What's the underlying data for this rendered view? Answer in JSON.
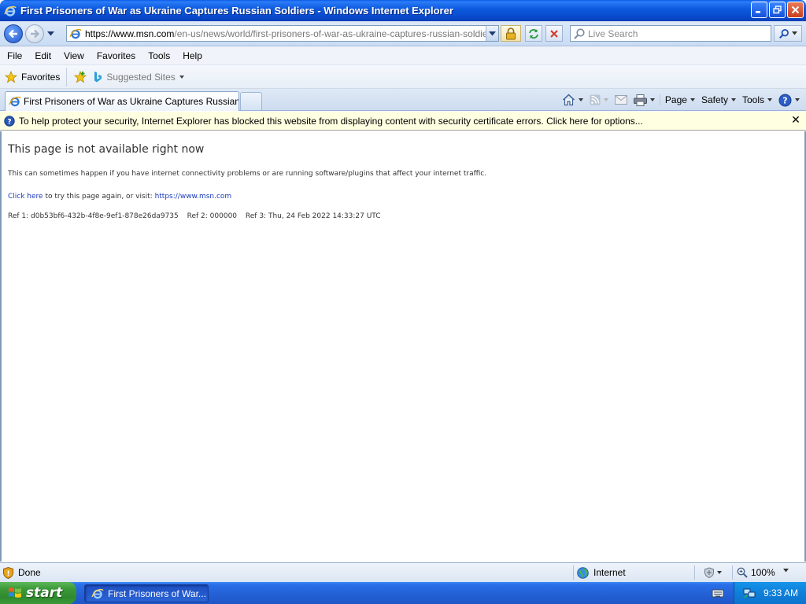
{
  "window": {
    "title": "First Prisoners of War as Ukraine Captures Russian Soldiers - Windows Internet Explorer"
  },
  "address_bar": {
    "url_prefix": "https://www.msn.com",
    "url_rest": "/en-us/news/world/first-prisoners-of-war-as-ukraine-captures-russian-soldiers/ar-A"
  },
  "search": {
    "placeholder": "Live Search"
  },
  "menu": [
    "File",
    "Edit",
    "View",
    "Favorites",
    "Tools",
    "Help"
  ],
  "favorites_bar": {
    "favorites_label": "Favorites",
    "suggested_label": "Suggested Sites"
  },
  "tabs": [
    {
      "label": "First Prisoners of War as Ukraine Captures Russian So..."
    }
  ],
  "command_bar": {
    "page": "Page",
    "safety": "Safety",
    "tools": "Tools"
  },
  "info_bar": {
    "text": "To help protect your security, Internet Explorer has blocked this website from displaying content with security certificate errors. Click here for options..."
  },
  "page": {
    "heading": "This page is not available right now",
    "message": "This can sometimes happen if you have internet connectivity problems or are running software/plugins that affect your internet traffic.",
    "retry_link": "Click here",
    "retry_text": " to try this page again, or visit: ",
    "site_link": "https://www.msn.com",
    "ref1": "Ref 1: d0b53bf6-432b-4f8e-9ef1-878e26da9735",
    "ref2": "Ref 2: 000000",
    "ref3": "Ref 3: Thu, 24 Feb 2022 14:33:27 UTC"
  },
  "status_bar": {
    "status": "Done",
    "zone": "Internet",
    "zoom": "100%"
  },
  "taskbar": {
    "start_label": "start",
    "task_label": "First Prisoners of War...",
    "clock": "9:33 AM"
  },
  "colors": {
    "titlebar_blue": "#0d5be0",
    "infobar_yellow": "#ffffe1",
    "link_blue": "#1b3dbd",
    "start_green": "#3c9a3a",
    "tray_blue": "#0f7fd8"
  }
}
